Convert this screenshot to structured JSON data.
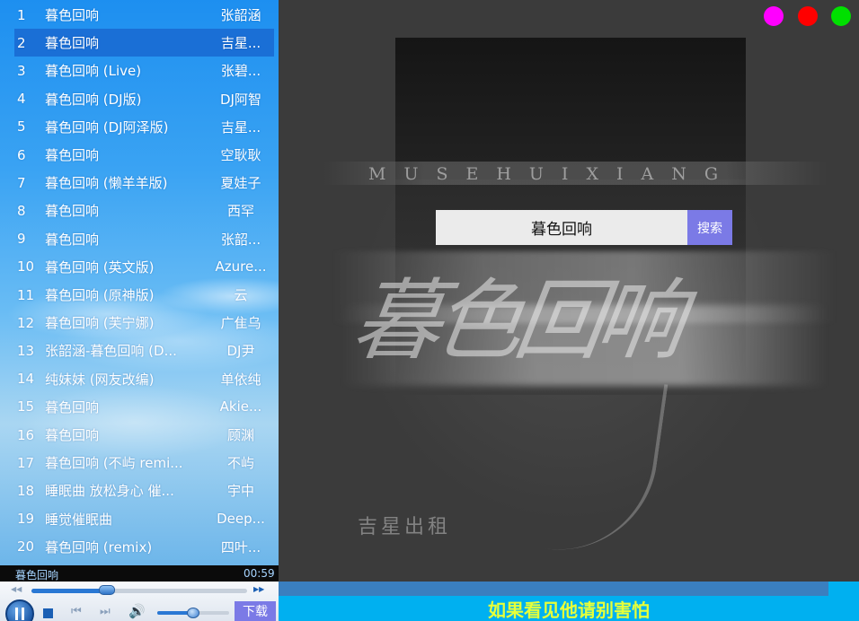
{
  "playlist": {
    "tracks": [
      {
        "num": "1",
        "title": "暮色回响",
        "artist": "张韶涵"
      },
      {
        "num": "2",
        "title": "暮色回响",
        "artist": "吉星..."
      },
      {
        "num": "3",
        "title": "暮色回响 (Live)",
        "artist": "张碧..."
      },
      {
        "num": "4",
        "title": "暮色回响 (DJ版)",
        "artist": "DJ阿智"
      },
      {
        "num": "5",
        "title": "暮色回响 (DJ阿泽版)",
        "artist": "吉星..."
      },
      {
        "num": "6",
        "title": "暮色回响",
        "artist": "空耿耿"
      },
      {
        "num": "7",
        "title": "暮色回响 (懒羊羊版)",
        "artist": "夏娃子"
      },
      {
        "num": "8",
        "title": "暮色回响",
        "artist": "西罕"
      },
      {
        "num": "9",
        "title": "暮色回响",
        "artist": "张韶..."
      },
      {
        "num": "10",
        "title": "暮色回响 (英文版)",
        "artist": "Azure..."
      },
      {
        "num": "11",
        "title": "暮色回响 (原神版)",
        "artist": "云"
      },
      {
        "num": "12",
        "title": "暮色回响 (芙宁娜)",
        "artist": "广隹乌"
      },
      {
        "num": "13",
        "title": "张韶涵-暮色回响 (D...",
        "artist": "DJ尹"
      },
      {
        "num": "14",
        "title": "纯妹妹 (网友改编)",
        "artist": "单依纯"
      },
      {
        "num": "15",
        "title": "暮色回响",
        "artist": "Akie..."
      },
      {
        "num": "16",
        "title": "暮色回响",
        "artist": "顾渊"
      },
      {
        "num": "17",
        "title": "暮色回响 (不屿 remi...",
        "artist": "不屿"
      },
      {
        "num": "18",
        "title": "睡眠曲 放松身心 催...",
        "artist": "宇中"
      },
      {
        "num": "19",
        "title": "睡觉催眠曲",
        "artist": "Deep..."
      },
      {
        "num": "20",
        "title": "暮色回响 (remix)",
        "artist": "四叶..."
      }
    ],
    "active_index": 1
  },
  "player": {
    "now_playing": "暮色回响",
    "time": "00:59",
    "progress": 0.35,
    "volume": 0.5,
    "download_label": "下载"
  },
  "search": {
    "value": "暮色回响",
    "button_label": "搜索"
  },
  "cover": {
    "band_text": "MUSEHUIXIANG",
    "calligraphy": "暮色回响",
    "bottom_text": "吉星出租"
  },
  "lyrics": {
    "current_line": "如果看见他请别害怕"
  },
  "colors": {
    "accent": "#7b7ae6",
    "lyric": "#e6ff3a",
    "dot_magenta": "#ff00ff",
    "dot_red": "#ff0000",
    "dot_green": "#00e000"
  }
}
